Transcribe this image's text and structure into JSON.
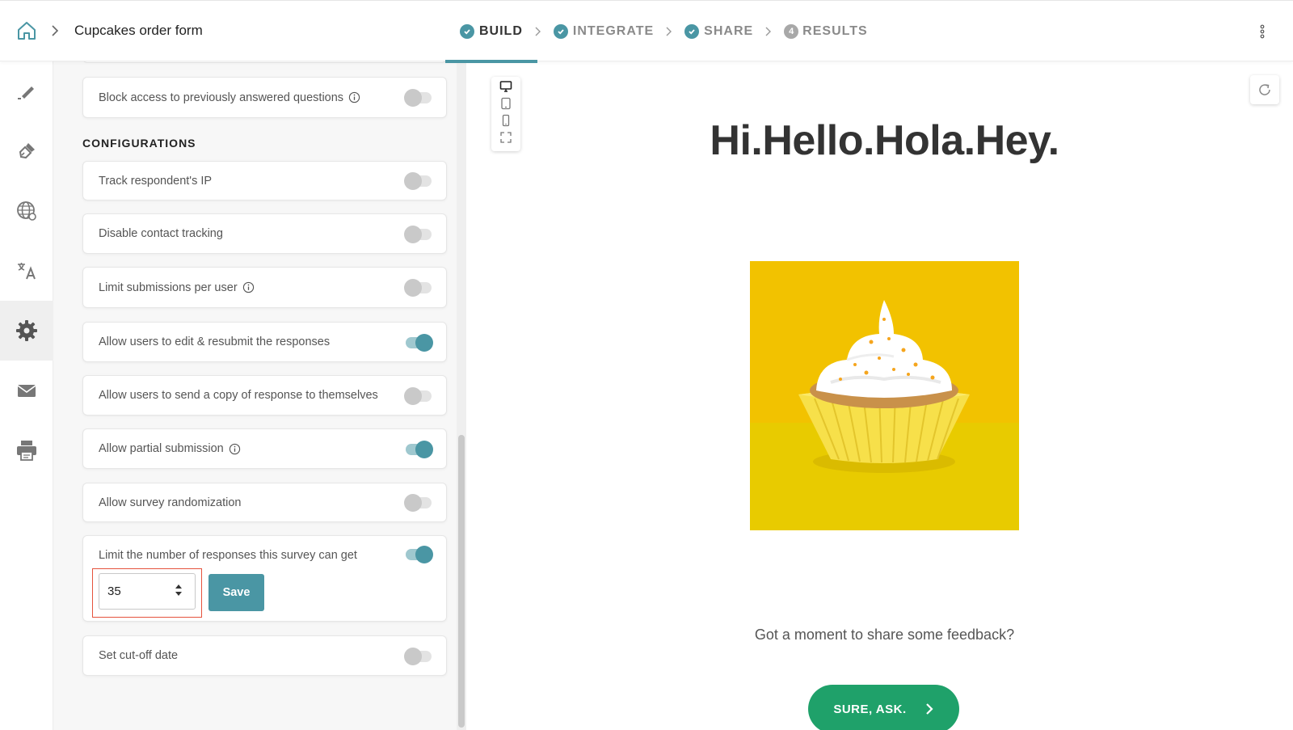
{
  "header": {
    "form_title": "Cupcakes order form",
    "steps": [
      {
        "label": "BUILD",
        "state": "done",
        "active": true
      },
      {
        "label": "INTEGRATE",
        "state": "done",
        "active": false
      },
      {
        "label": "SHARE",
        "state": "done",
        "active": false
      },
      {
        "label": "RESULTS",
        "state": "pending",
        "number": "4",
        "active": false
      }
    ]
  },
  "rail": {
    "items": [
      {
        "icon": "pencil-icon"
      },
      {
        "icon": "paint-brush-icon"
      },
      {
        "icon": "globe-icon"
      },
      {
        "icon": "translate-icon"
      },
      {
        "icon": "gear-icon",
        "active": true
      },
      {
        "icon": "mail-icon"
      },
      {
        "icon": "printer-icon"
      }
    ]
  },
  "settings": {
    "top_item": {
      "label": "Block access to previously answered questions",
      "on": false
    },
    "section_title": "CONFIGURATIONS",
    "items": [
      {
        "label": "Track respondent's IP",
        "on": false
      },
      {
        "label": "Disable contact tracking",
        "on": false
      },
      {
        "label": "Limit submissions per user",
        "on": false,
        "info": true
      },
      {
        "label": "Allow users to edit & resubmit the responses",
        "on": true
      },
      {
        "label": "Allow users to send a copy of response to themselves",
        "on": false
      },
      {
        "label": "Allow partial submission",
        "on": true,
        "info": true
      },
      {
        "label": "Allow survey randomization",
        "on": false
      },
      {
        "label": "Limit the number of responses this survey can get",
        "on": true
      },
      {
        "label": "Set cut-off date",
        "on": false
      }
    ],
    "response_limit": {
      "value": "35",
      "save_label": "Save"
    }
  },
  "preview": {
    "welcome_title": "Hi.Hello.Hola.Hey.",
    "feedback_text": "Got a moment to share some feedback?",
    "cta_label": "SURE, ASK."
  },
  "colors": {
    "accent": "#4a96a4",
    "cta": "#1fa16a",
    "image_bg": "#f2c200",
    "highlight": "#e5533d"
  }
}
